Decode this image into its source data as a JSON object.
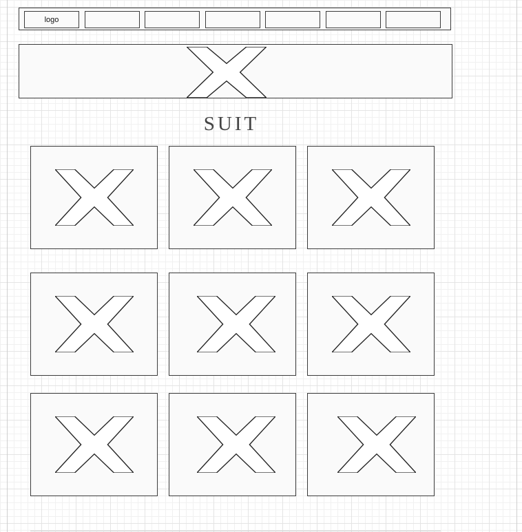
{
  "nav": {
    "items": [
      {
        "label": "logo"
      },
      {
        "label": ""
      },
      {
        "label": ""
      },
      {
        "label": ""
      },
      {
        "label": ""
      },
      {
        "label": ""
      },
      {
        "label": ""
      }
    ]
  },
  "banner": {
    "icon": "placeholder-x-icon"
  },
  "section": {
    "title": "SUIT"
  },
  "grid": {
    "rows": 3,
    "columns": 3,
    "card_icon": "placeholder-x-icon"
  },
  "colors": {
    "stroke": "#3a3a3a",
    "fill": "#fafafa",
    "grid": "#e4e4e4"
  }
}
